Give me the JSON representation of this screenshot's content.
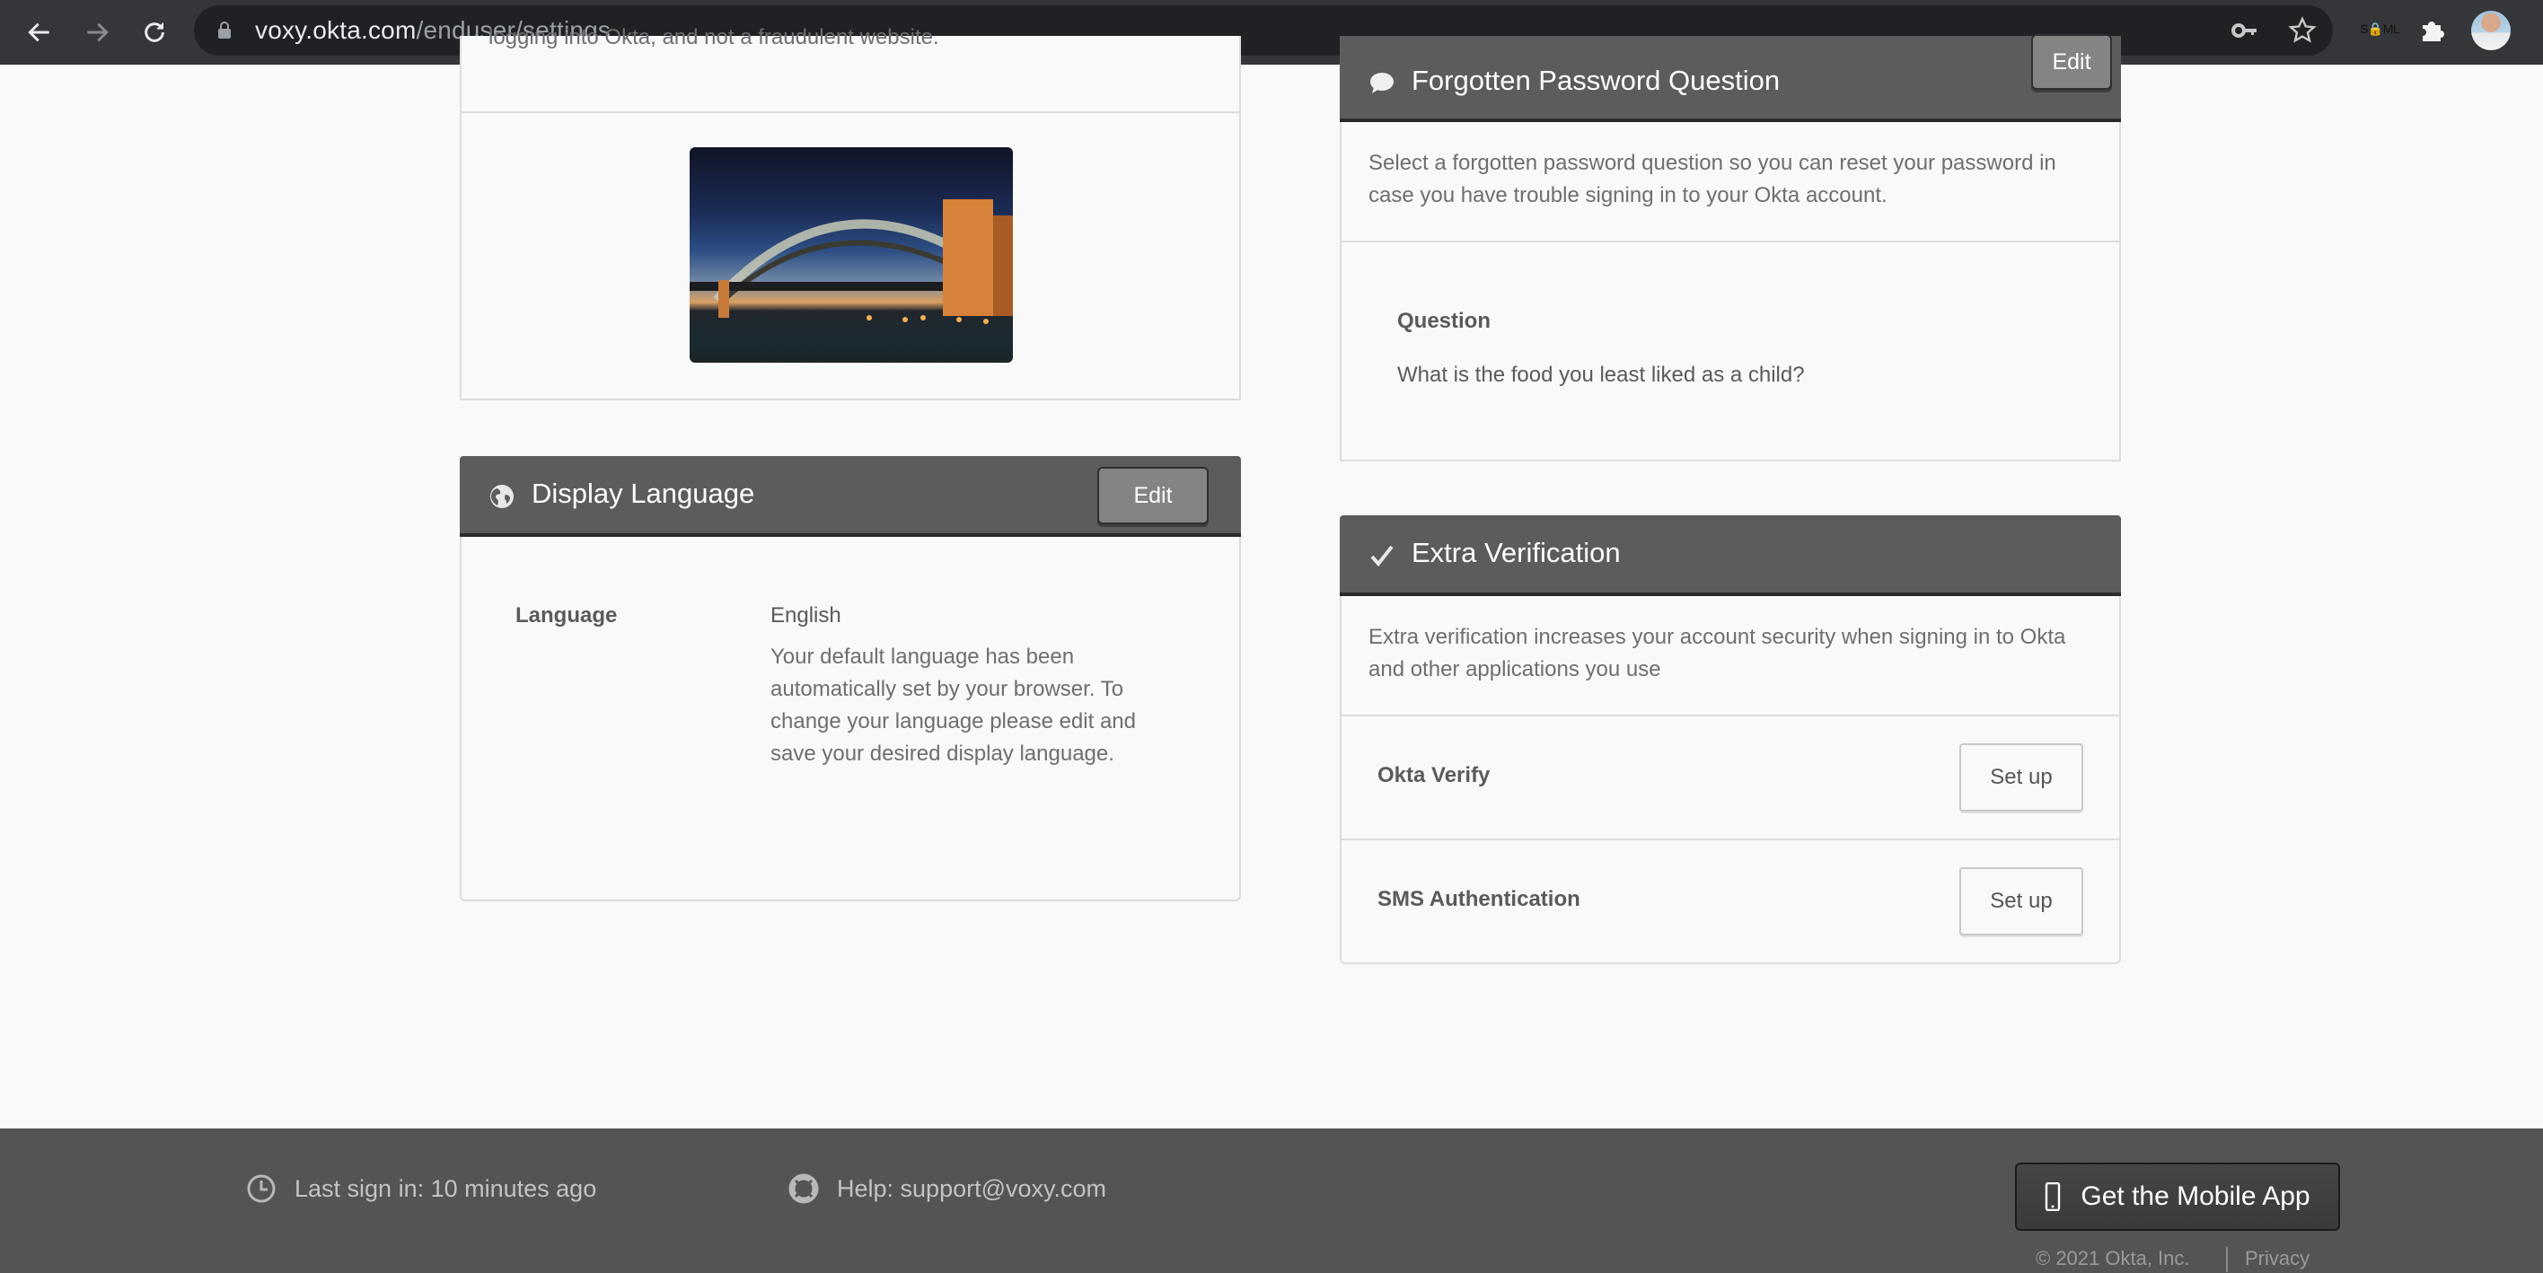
{
  "browser": {
    "url_host": "voxy.okta.com",
    "url_path": "/enduser/settings",
    "extension_label": "S🔒ML",
    "icons": [
      "back-arrow-icon",
      "forward-arrow-icon",
      "reload-icon",
      "lock-icon",
      "key-icon",
      "star-icon",
      "puzzle-icon",
      "avatar"
    ]
  },
  "security_image": {
    "description_tail": "logging into Okta, and not a fraudulent website.",
    "image_alt": "Sydney Harbour Bridge at dusk"
  },
  "display_language": {
    "title": "Display Language",
    "icon": "globe-icon",
    "edit_label": "Edit",
    "field_label": "Language",
    "field_value": "English",
    "help_text": "Your default language has been automatically set by your browser. To change your language please edit and save your desired display language."
  },
  "forgotten_password": {
    "title": "Forgotten Password Question",
    "icon": "speech-bubble-icon",
    "edit_label": "Edit",
    "description": "Select a forgotten password question so you can reset your password in case you have trouble signing in to your Okta account.",
    "question_label": "Question",
    "question_value": "What is the food you least liked as a child?"
  },
  "extra_verification": {
    "title": "Extra Verification",
    "icon": "checkmark-icon",
    "description": "Extra verification increases your account security when signing in to Okta and other applications you use",
    "factors": [
      {
        "name": "Okta Verify",
        "action": "Set up"
      },
      {
        "name": "SMS Authentication",
        "action": "Set up"
      }
    ]
  },
  "footer": {
    "last_sign_in": "Last sign in: 10 minutes ago",
    "help": "Help: support@voxy.com",
    "mobile_app_label": "Get the Mobile App",
    "copyright": "© 2021 Okta, Inc.",
    "privacy": "Privacy"
  },
  "colors": {
    "panel_header": "#5c5c5c",
    "footer_bg": "#545454",
    "page_bg": "#f9f9f9",
    "chrome_bg": "#35363a"
  }
}
